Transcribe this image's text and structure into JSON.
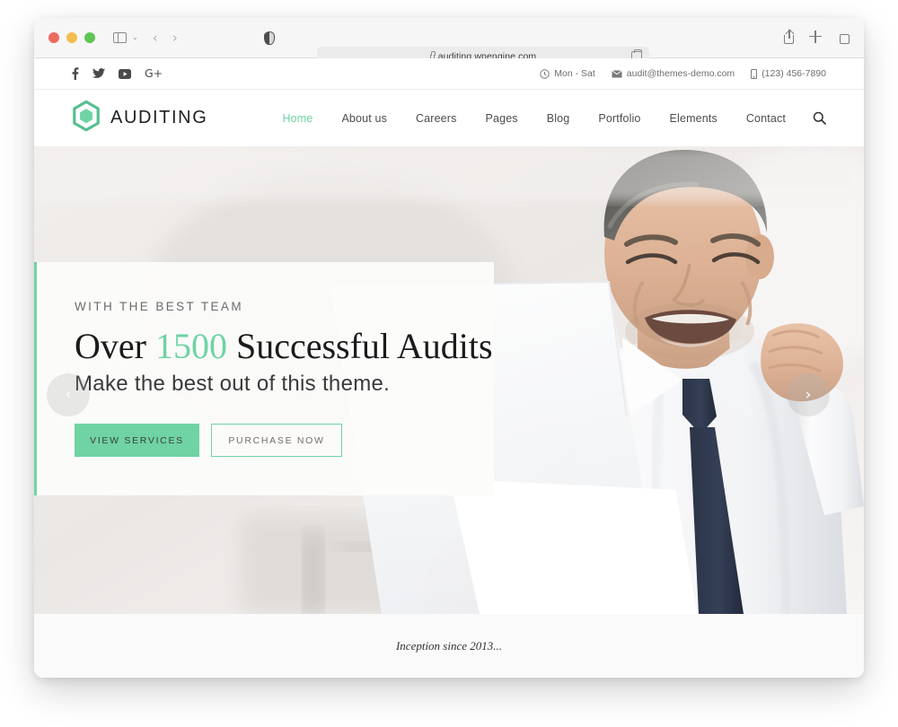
{
  "browser": {
    "url": "auditing.wpengine.com",
    "lock_icon": "lock-icon",
    "shield_icon": "privacy-shield-icon",
    "reader_icon": "reader-view-icon",
    "sidebar_icon": "sidebar-toggle-icon",
    "back_icon": "‹",
    "forward_icon": "›",
    "share_icon": "share-icon",
    "newtab_icon": "new-tab-icon",
    "tabs_icon": "tab-overview-icon",
    "chevron_icon": "⌄"
  },
  "topbar": {
    "socials": [
      {
        "name": "facebook-icon",
        "glyph": "f"
      },
      {
        "name": "twitter-icon",
        "glyph": "twitter"
      },
      {
        "name": "youtube-icon",
        "glyph": "youtube"
      },
      {
        "name": "googleplus-icon",
        "glyph": "G+"
      }
    ],
    "hours": "Mon - Sat",
    "email": "audit@themes-demo.com",
    "phone": "(123) 456-7890"
  },
  "header": {
    "brand": "AUDITING",
    "logo_icon": "hexagon-logo-icon",
    "nav": [
      {
        "label": "Home",
        "active": true
      },
      {
        "label": "About us",
        "active": false
      },
      {
        "label": "Careers",
        "active": false
      },
      {
        "label": "Pages",
        "active": false
      },
      {
        "label": "Blog",
        "active": false
      },
      {
        "label": "Portfolio",
        "active": false
      },
      {
        "label": "Elements",
        "active": false
      },
      {
        "label": "Contact",
        "active": false
      }
    ],
    "search_icon": "search-icon"
  },
  "hero": {
    "kicker": "WITH THE BEST TEAM",
    "title_pre": "Over ",
    "title_number": "1500",
    "title_post": " Successful Audits",
    "subtitle": "Make the best out of this theme.",
    "primary_button": "VIEW SERVICES",
    "secondary_button": "PURCHASE NOW",
    "prev_arrow": "‹",
    "next_arrow": "›",
    "accent_color": "#6fd3a3"
  },
  "footer": {
    "tagline": "Inception since 2013..."
  }
}
